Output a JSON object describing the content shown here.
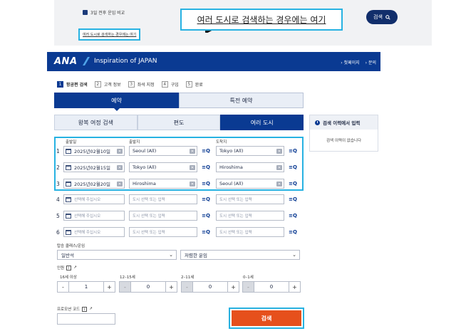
{
  "top_inset": {
    "checkbox_label": "3일 전후 운임 비교",
    "small_link": "여러 도시로 검색하는 경우에는 여기",
    "big_link": "여러 도시로 검색하는 경우에는 여기",
    "search_button": "검색"
  },
  "header": {
    "logo": "ANA",
    "brand": "Inspiration of JAPAN",
    "links": [
      "› 첫페이지",
      "› 문의"
    ]
  },
  "steps": [
    {
      "num": "1",
      "label": "항공편 검색",
      "active": true
    },
    {
      "num": "2",
      "label": "고객 정보",
      "active": false
    },
    {
      "num": "3",
      "label": "좌석 지정",
      "active": false
    },
    {
      "num": "4",
      "label": "구입",
      "active": false
    },
    {
      "num": "5",
      "label": "완료",
      "active": false
    }
  ],
  "main_tabs": [
    "예약",
    "특전 예약"
  ],
  "sub_tabs": [
    "왕복 여정 검색",
    "편도",
    "여러 도시"
  ],
  "history": {
    "title": "검색 이력에서 입력",
    "empty": "검색 이력이 없습니다"
  },
  "columns": {
    "date": "출발일",
    "origin": "출발지",
    "dest": "도착지"
  },
  "rows": [
    {
      "num": "1",
      "date": "2025년02월10일",
      "origin": "Seoul (All)",
      "dest": "Tokyo (All)"
    },
    {
      "num": "2",
      "date": "2025년02월15일",
      "origin": "Tokyo (All)",
      "dest": "Hiroshima"
    },
    {
      "num": "3",
      "date": "2025년02월20일",
      "origin": "Hiroshima",
      "dest": "Seoul (All)"
    },
    {
      "num": "4",
      "date_placeholder": "선택해 주십시오",
      "city_placeholder": "도시 선택 또는 입력"
    },
    {
      "num": "5",
      "date_placeholder": "선택해 주십시오",
      "city_placeholder": "도시 선택 또는 입력"
    },
    {
      "num": "6",
      "date_placeholder": "선택해 주십시오",
      "city_placeholder": "도시 선택 또는 입력"
    }
  ],
  "class_fare": {
    "label": "탑승 클래스/운임",
    "cabin": "일반석",
    "fare": "저렴한 운임"
  },
  "pax": {
    "label": "인원",
    "groups": [
      {
        "label": "16세 이상",
        "value": "1"
      },
      {
        "label": "12–15세",
        "value": "0"
      },
      {
        "label": "2–11세",
        "value": "0"
      },
      {
        "label": "0–1세",
        "value": "0"
      }
    ]
  },
  "promo": {
    "label": "프로모션 코드"
  },
  "search_button": "검색",
  "colors": {
    "brand_blue": "#0a3a92",
    "highlight": "#27b2e2",
    "search_orange": "#e6501c"
  }
}
